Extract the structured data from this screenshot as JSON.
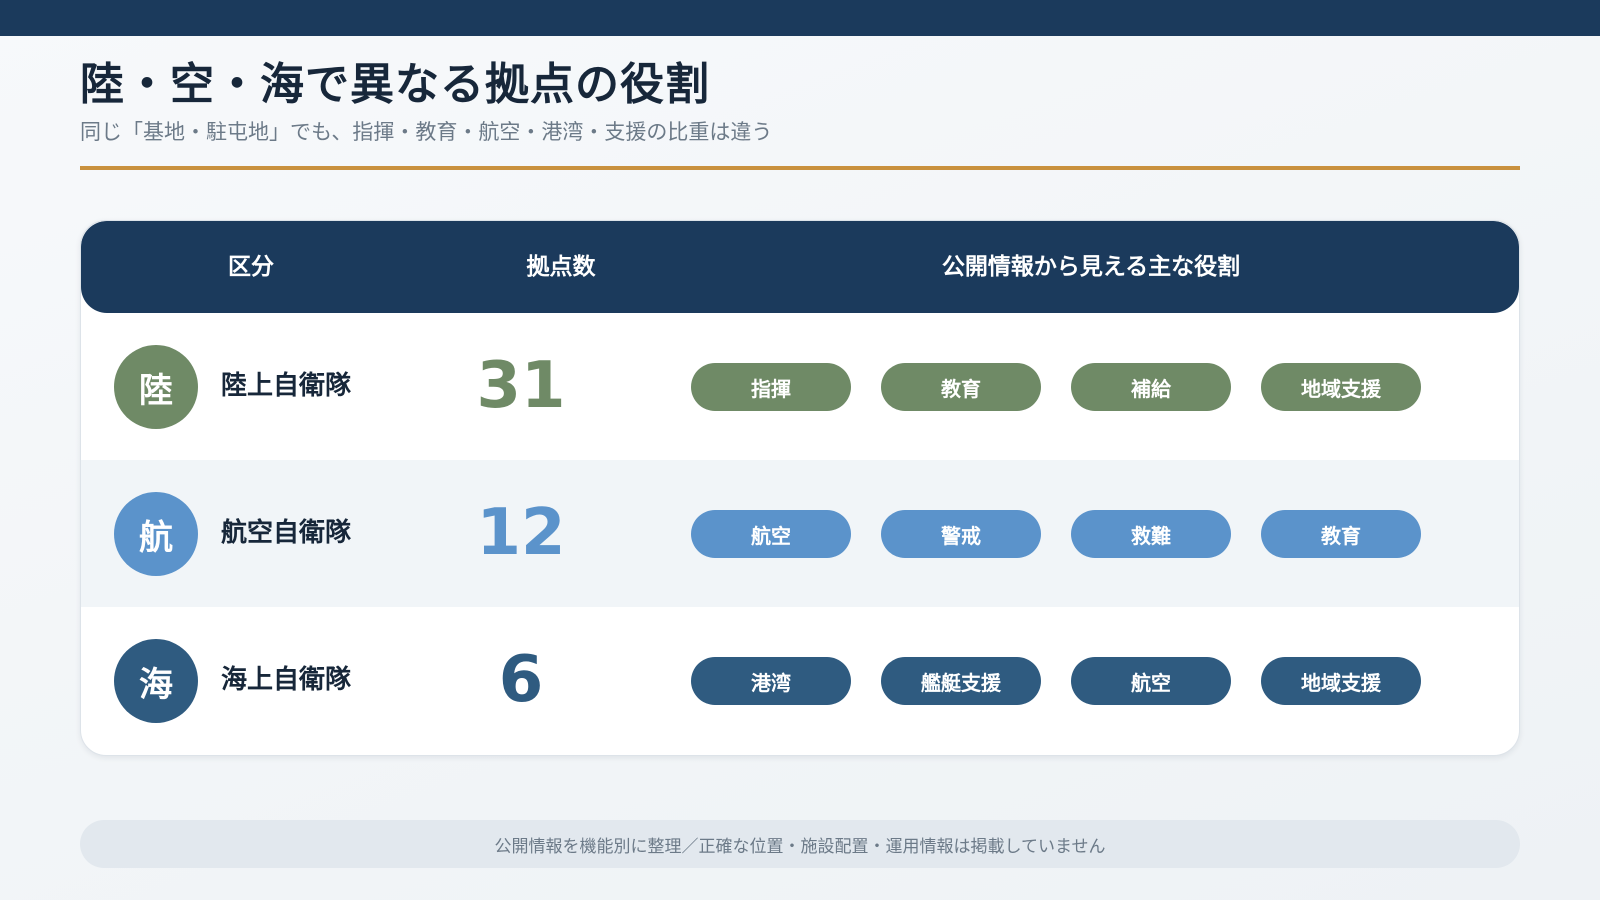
{
  "header": {
    "title": "陸・空・海で異なる拠点の役割",
    "subtitle": "同じ「基地・駐屯地」でも、指揮・教育・航空・港湾・支援の比重は違う"
  },
  "table": {
    "columns": {
      "category": "区分",
      "count": "拠点数",
      "roles": "公開情報から見える主な役割"
    },
    "rows": [
      {
        "badge": "陸",
        "name": "陸上自衛隊",
        "count": "31",
        "color": "#6f8a66",
        "tags": [
          "指揮",
          "教育",
          "補給",
          "地域支援"
        ]
      },
      {
        "badge": "航",
        "name": "航空自衛隊",
        "count": "12",
        "color": "#5b93cb",
        "tags": [
          "航空",
          "警戒",
          "救難",
          "教育"
        ]
      },
      {
        "badge": "海",
        "name": "海上自衛隊",
        "count": "6",
        "color": "#2f5b80",
        "tags": [
          "港湾",
          "艦艇支援",
          "航空",
          "地域支援"
        ]
      }
    ]
  },
  "footer": {
    "note": "公開情報を機能別に整理／正確な位置・施設配置・運用情報は掲載していません"
  }
}
